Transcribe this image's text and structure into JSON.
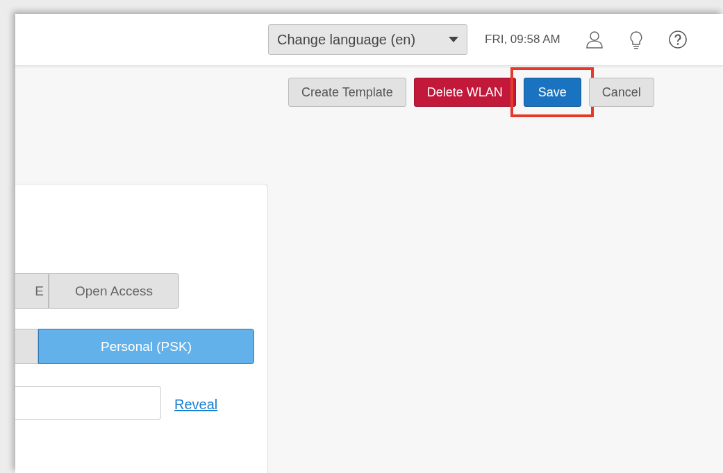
{
  "header": {
    "language_select": {
      "value": "Change language (en)"
    },
    "datetime": "FRI, 09:58 AM"
  },
  "toolbar": {
    "buttons": [
      {
        "label": "Create Template",
        "kind": "default",
        "highlighted": false
      },
      {
        "label": "Delete WLAN",
        "kind": "danger",
        "highlighted": false
      },
      {
        "label": "Save",
        "kind": "primary",
        "highlighted": true
      },
      {
        "label": "Cancel",
        "kind": "default",
        "highlighted": false
      }
    ]
  },
  "card": {
    "access_modes": [
      {
        "label": "E",
        "selected": false
      },
      {
        "label": "Open Access",
        "selected": false
      }
    ],
    "auth_modes": [
      {
        "selected": false
      },
      {
        "label": "Personal (PSK)",
        "selected": true
      }
    ],
    "reveal_link": "Reveal"
  }
}
